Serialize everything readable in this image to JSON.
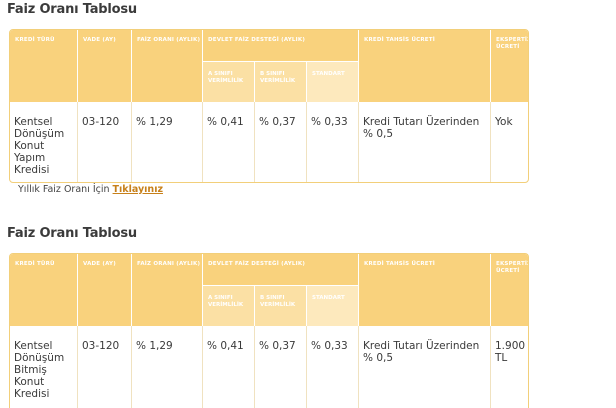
{
  "headers": {
    "kredi_turu": "KREDİ TÜRÜ",
    "vade": "VADE (AY)",
    "faiz_orani": "FAİZ ORANI (AYLIK)",
    "devlet_destegi": "DEVLET FAİZ DESTEĞİ (AYLIK)",
    "a_sinifi": "A SINIFI VERİMLİLİK",
    "b_sinifi": "B SINIFI VERİMLİLİK",
    "standart": "STANDART",
    "tahsis_ucreti": "KREDİ TAHSİS ÜCRETİ",
    "ekspertiz": "EKSPERTİZ ÜCRETİ"
  },
  "sections": [
    {
      "title": "Faiz Oranı Tablosu",
      "row": {
        "kredi_turu": "Kentsel Dönüşüm Konut Yapım Kredisi",
        "vade": "03-120",
        "faiz": "% 1,29",
        "a": "% 0,41",
        "b": "% 0,37",
        "standart": "% 0,33",
        "tahsis": "Kredi Tutarı Üzerinden % 0,5",
        "ekspertiz": "Yok"
      }
    },
    {
      "title": "Faiz Oranı Tablosu",
      "row": {
        "kredi_turu": "Kentsel Dönüşüm Bitmiş Konut Kredisi",
        "vade": "03-120",
        "faiz": "% 1,29",
        "a": "% 0,41",
        "b": "% 0,37",
        "standart": "% 0,33",
        "tahsis": "Kredi Tutarı Üzerinden % 0,5",
        "ekspertiz": "1.900 TL"
      }
    }
  ],
  "note": {
    "text": "Yıllık Faiz Oranı İçin",
    "link": "Tıklayınız"
  },
  "colors": {
    "header": "#f9d27d",
    "subheader": "#fbe0a4",
    "link": "#c7801a"
  }
}
